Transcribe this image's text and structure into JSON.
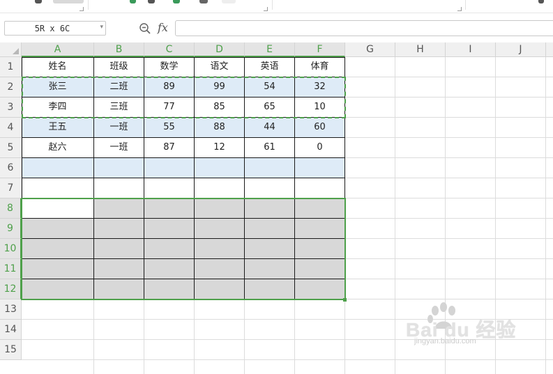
{
  "toolbar": {
    "items": [
      "ribbon-button-1",
      "ribbon-button-2",
      "ribbon-button-3",
      "ribbon-button-4"
    ]
  },
  "formula_bar": {
    "name_box_value": "5R x 6C",
    "fx_label": "fx",
    "formula_value": ""
  },
  "columns": [
    "A",
    "B",
    "C",
    "D",
    "E",
    "F",
    "G",
    "H",
    "I",
    "J"
  ],
  "rows": [
    "1",
    "2",
    "3",
    "4",
    "5",
    "6",
    "7",
    "8",
    "9",
    "10",
    "11",
    "12",
    "13",
    "14",
    "15"
  ],
  "table": {
    "header": [
      "姓名",
      "班级",
      "数学",
      "语文",
      "英语",
      "体育"
    ],
    "rows": [
      [
        "张三",
        "二班",
        "89",
        "99",
        "54",
        "32"
      ],
      [
        "李四",
        "三班",
        "77",
        "85",
        "65",
        "10"
      ],
      [
        "王五",
        "一班",
        "55",
        "88",
        "44",
        "60"
      ],
      [
        "赵六",
        "一班",
        "87",
        "12",
        "61",
        "0"
      ]
    ]
  },
  "selection": {
    "name": "A8:F12",
    "rows_selected": 5,
    "cols_selected": 6
  },
  "copy_range": "A2:F3",
  "colors": {
    "accent_green": "#4ea04a",
    "band_blue": "#deebf7",
    "selected_fill": "#d8d8d8"
  },
  "watermark": {
    "brand": "Bai du 经验",
    "url": "jingyan.baidu.com"
  }
}
